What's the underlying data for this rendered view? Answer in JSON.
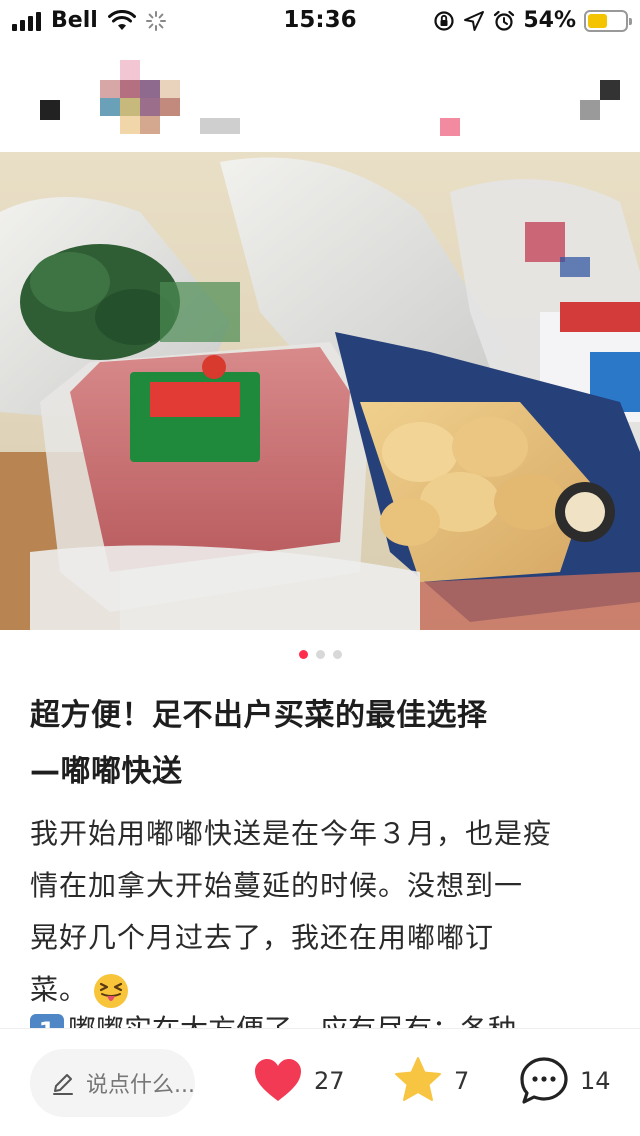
{
  "status_bar": {
    "carrier": "Bell",
    "time": "15:36",
    "battery_percent": "54%",
    "battery_level": 0.54,
    "icons": [
      "signal-icon",
      "wifi-icon",
      "loading-icon",
      "orientation-lock-icon",
      "location-icon",
      "alarm-icon",
      "battery-icon"
    ]
  },
  "carousel": {
    "total": 3,
    "active_index": 0
  },
  "post": {
    "title_line1": "超方便！足不出户买菜的最佳选择",
    "title_line2": "—嘟嘟快送",
    "body_line1": "我开始用嘟嘟快送是在今年３月，也是疫",
    "body_line2": "情在加拿大开始蔓延的时候。没想到一",
    "body_line3": "晃好几个月过去了，我还在用嘟嘟订",
    "body_line4": "菜。",
    "emoji": "squinting-tongue-emoji",
    "list_marker": "1",
    "body_line5_partial": "嘟嘟实在太方便了，应有尽有：各种"
  },
  "bottom_bar": {
    "comment_placeholder": "说点什么...",
    "like_count": "27",
    "favorite_count": "7",
    "comment_count": "14"
  },
  "colors": {
    "accent": "#ff2e4d",
    "heart": "#f23a55",
    "star": "#f7c541",
    "battery": "#f5c400"
  }
}
